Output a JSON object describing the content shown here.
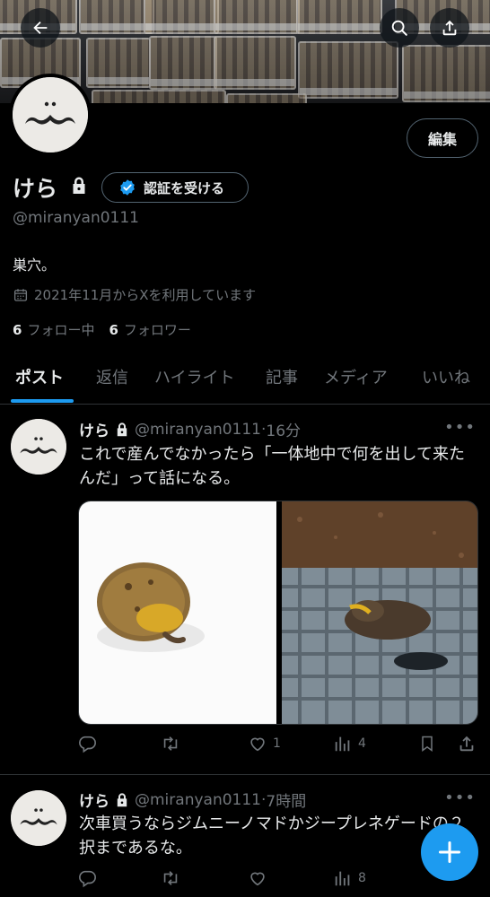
{
  "header": {
    "back_icon": "arrow-left-icon",
    "search_icon": "search-icon",
    "share_icon": "share-icon"
  },
  "profile": {
    "edit_label": "編集",
    "name": "けら",
    "verify_label": "認証を受ける",
    "handle": "@miranyan0111",
    "bio": "巣穴。",
    "joined": "2021年11月からXを利用しています",
    "following_count": "6",
    "following_label": "フォロー中",
    "followers_count": "6",
    "followers_label": "フォロワー"
  },
  "tabs": [
    "ポスト",
    "返信",
    "ハイライト",
    "記事",
    "メディア",
    "いいね"
  ],
  "active_tab": "ポスト",
  "posts": [
    {
      "name": "けら",
      "handle": "@miranyan0111",
      "sep": "·",
      "time": "16分",
      "text": "これで産んでなかったら「一体地中で何を出して来たんだ」って話になる。",
      "replies": "",
      "reposts": "",
      "likes": "1",
      "views": "4"
    },
    {
      "name": "けら",
      "handle": "@miranyan0111",
      "sep": "·",
      "time": "7時間",
      "text": "次車買うならジムニーノマドかジープレネゲードの２択まであるな。",
      "replies": "",
      "reposts": "",
      "likes": "",
      "views": "8"
    }
  ],
  "colors": {
    "accent": "#1d9bf0",
    "background": "#000000",
    "text_primary": "#e7e9ea",
    "text_secondary": "#71767b",
    "border": "#2f3336"
  }
}
